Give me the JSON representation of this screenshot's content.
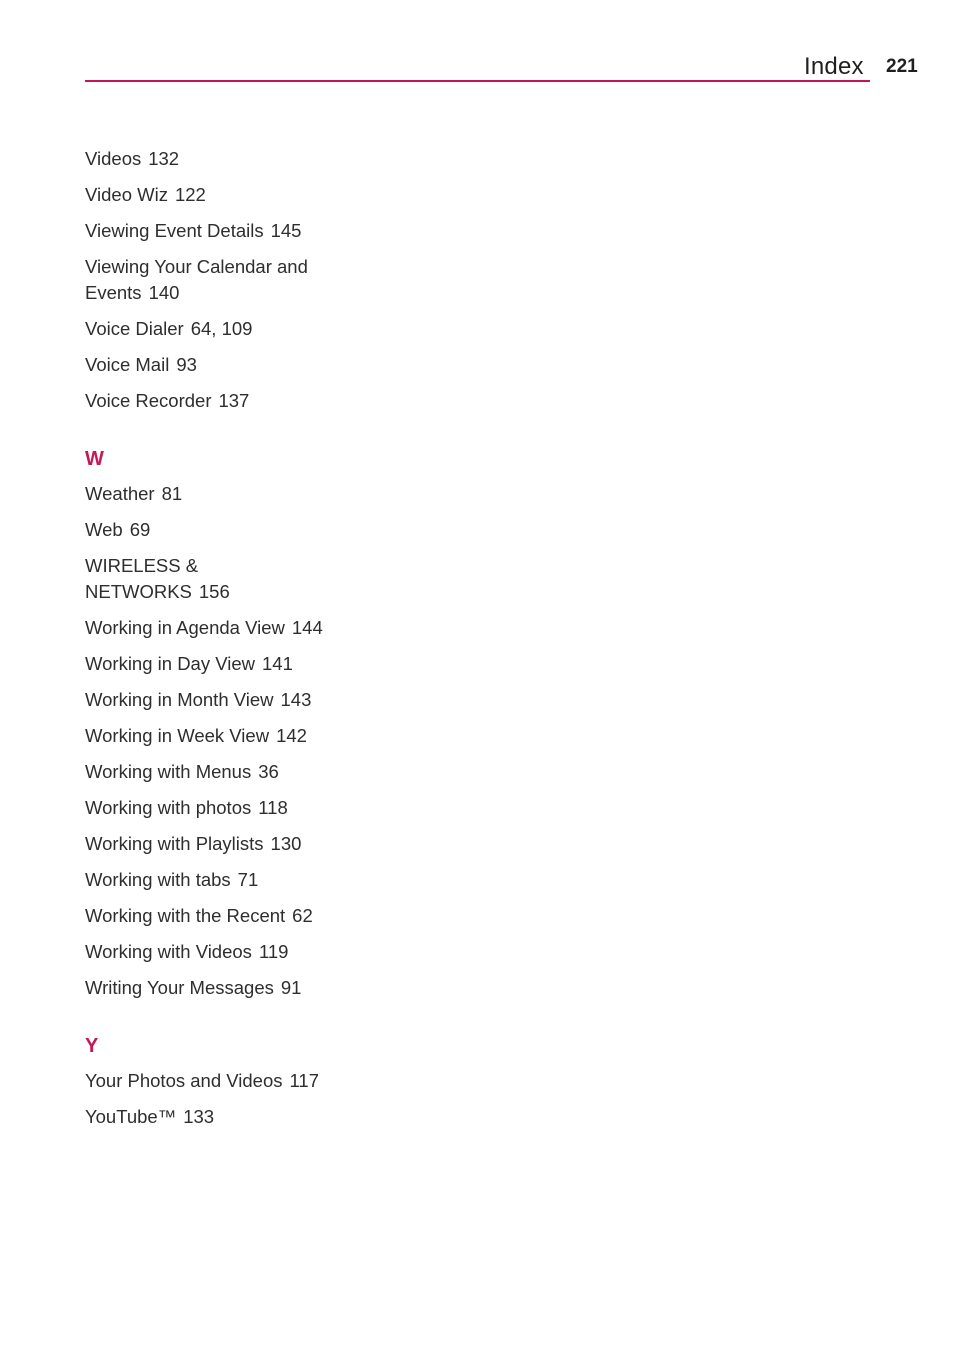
{
  "header": {
    "title": "Index",
    "page_number": "221",
    "accent_color": "#c2185b"
  },
  "sections": [
    {
      "letter": "",
      "entries": [
        {
          "term": "Videos",
          "pages": "132"
        },
        {
          "term": "Video Wiz",
          "pages": "122"
        },
        {
          "term": "Viewing Event Details",
          "pages": "145"
        },
        {
          "term": "Viewing Your Calendar and Events",
          "pages": "140"
        },
        {
          "term": "Voice Dialer",
          "pages": "64, 109"
        },
        {
          "term": "Voice Mail",
          "pages": "93"
        },
        {
          "term": "Voice Recorder",
          "pages": "137"
        }
      ]
    },
    {
      "letter": "W",
      "entries": [
        {
          "term": "Weather",
          "pages": "81"
        },
        {
          "term": "Web",
          "pages": "69"
        },
        {
          "term": "WIRELESS & NETWORKS",
          "pages": "156"
        },
        {
          "term": "Working in Agenda View",
          "pages": "144"
        },
        {
          "term": "Working in Day View",
          "pages": "141"
        },
        {
          "term": "Working in Month View",
          "pages": "143"
        },
        {
          "term": "Working in Week View",
          "pages": "142"
        },
        {
          "term": "Working with Menus",
          "pages": "36"
        },
        {
          "term": "Working with photos",
          "pages": "118"
        },
        {
          "term": "Working with Playlists",
          "pages": "130"
        },
        {
          "term": "Working with tabs",
          "pages": "71"
        },
        {
          "term": "Working with the Recent",
          "pages": "62"
        },
        {
          "term": "Working with Videos",
          "pages": "119"
        },
        {
          "term": "Writing Your Messages",
          "pages": "91"
        }
      ]
    },
    {
      "letter": "Y",
      "entries": [
        {
          "term": "Your Photos and Videos",
          "pages": "117"
        },
        {
          "term": "YouTube™",
          "pages": "133"
        }
      ]
    }
  ]
}
